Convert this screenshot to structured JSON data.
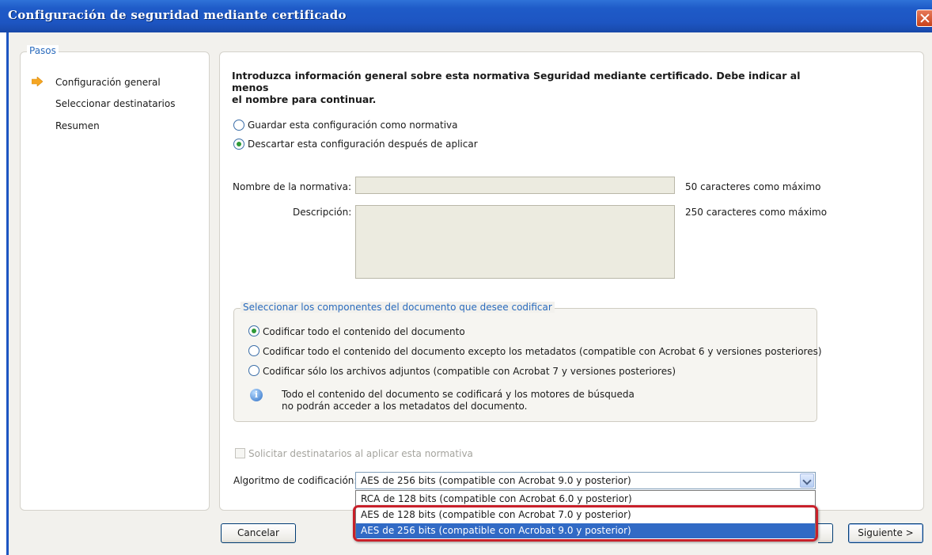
{
  "window": {
    "title": "Configuración de seguridad mediante certificado"
  },
  "steps": {
    "legend": "Pasos",
    "items": [
      "Configuración general",
      "Seleccionar destinatarios",
      "Resumen"
    ],
    "current": 0
  },
  "intro": {
    "line1": "Introduzca información general sobre esta normativa Seguridad mediante certificado. Debe indicar al menos",
    "line2": "el nombre para continuar."
  },
  "save_options": {
    "save_policy": "Guardar esta configuración como normativa",
    "discard_after": "Descartar esta configuración después de aplicar",
    "selected": "discard_after"
  },
  "fields": {
    "policy_name_label": "Nombre de la normativa:",
    "policy_name_value": "",
    "policy_name_hint": "50 caracteres como máximo",
    "description_label": "Descripción:",
    "description_value": "",
    "description_hint": "250 caracteres como máximo"
  },
  "components": {
    "legend": "Seleccionar los componentes del documento que desee codificar",
    "all": "Codificar todo el contenido del documento",
    "except_metadata": "Codificar todo el contenido del documento excepto los metadatos (compatible con Acrobat 6 y versiones posteriores)",
    "attachments_only": "Codificar sólo los archivos adjuntos (compatible con Acrobat 7 y versiones posteriores)",
    "selected": "all",
    "info_line1": "Todo el contenido del documento se codificará y los motores de búsqueda",
    "info_line2": "no podrán acceder a los metadatos del documento."
  },
  "request_recipients": {
    "label": "Solicitar destinatarios al aplicar esta normativa",
    "checked": false,
    "disabled": true
  },
  "algorithm": {
    "label": "Algoritmo de codificación:",
    "selected": "AES de 256 bits (compatible con Acrobat 9.0 y posterior)",
    "options": [
      "RCA de 128 bits (compatible con Acrobat 6.0 y posterior)",
      "AES de 128 bits (compatible con Acrobat 7.0 y posterior)",
      "AES de 256 bits (compatible con Acrobat 9.0 y posterior)"
    ],
    "highlighted_index": 2
  },
  "buttons": {
    "cancel": "Cancelar",
    "next": "Siguiente >"
  },
  "colors": {
    "titlebar": "#1d55c2",
    "accent_text": "#2a6bbd",
    "selection": "#316ac5",
    "annotation": "#c8202a",
    "field_bg": "#ecebe0"
  }
}
